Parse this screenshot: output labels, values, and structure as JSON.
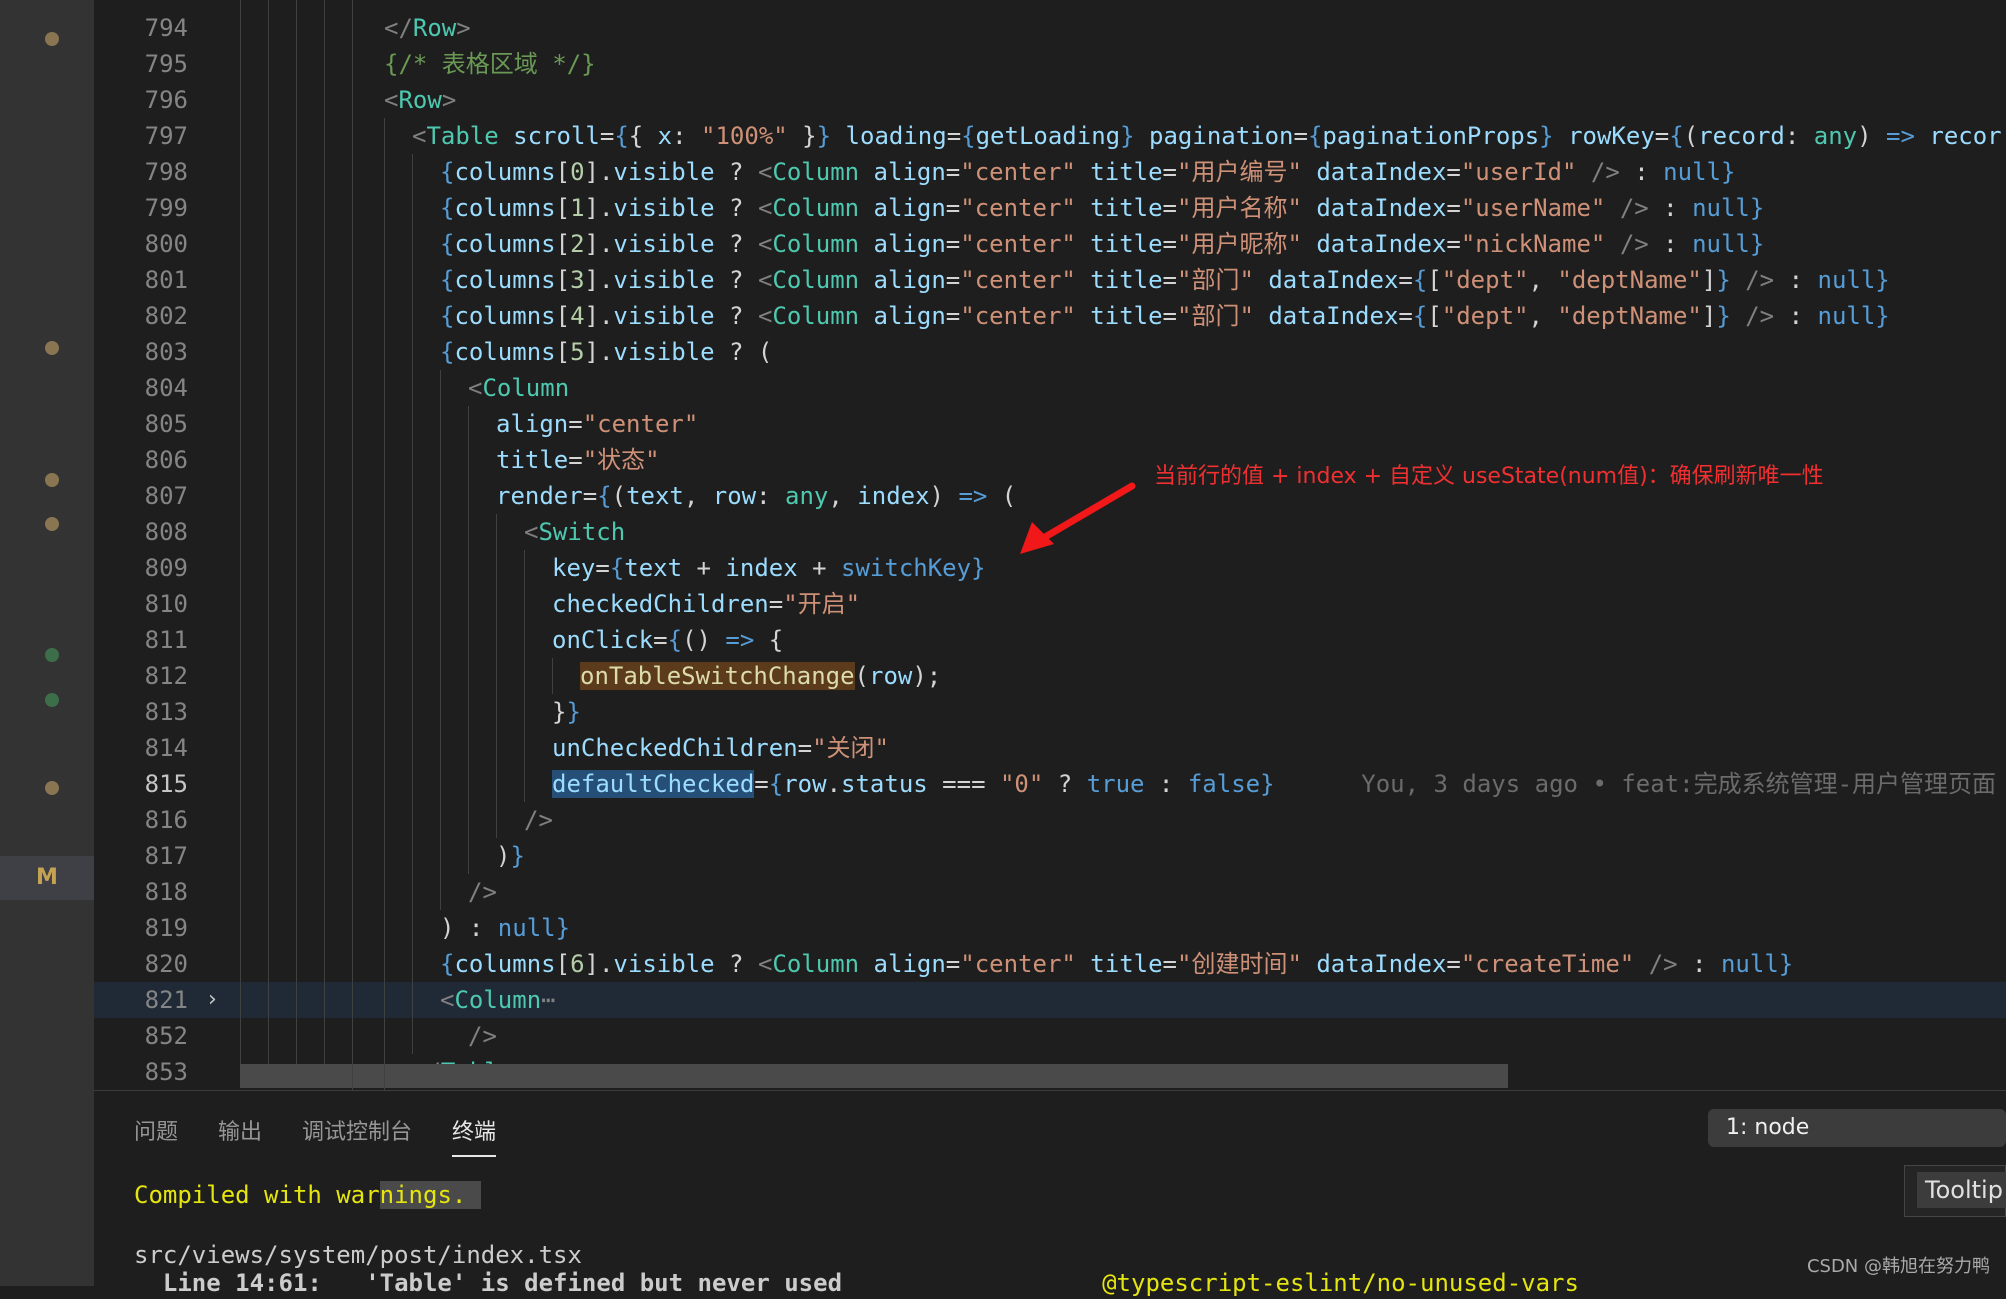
{
  "activity_bar": {
    "scm_badge": "M"
  },
  "editor": {
    "line_numbers": [
      "794",
      "795",
      "796",
      "797",
      "798",
      "799",
      "800",
      "801",
      "802",
      "803",
      "804",
      "805",
      "806",
      "807",
      "808",
      "809",
      "810",
      "811",
      "812",
      "813",
      "814",
      "815",
      "816",
      "817",
      "818",
      "819",
      "820",
      "821",
      "852",
      "853"
    ],
    "current_line": "815",
    "annotation": "当前行的值 + index + 自定义 useState(num值)：确保刷新唯一性",
    "blame": "You, 3 days ago • feat:完成系统管理-用户管理页面",
    "text": {
      "row": "Row",
      "comment": "{/* 表格区域 */}",
      "table": "Table",
      "column": "Column",
      "switch": "Switch",
      "scroll": "scroll",
      "loading": "loading",
      "pagination": "pagination",
      "rowKey": "rowKey",
      "getLoading": "getLoading",
      "paginationProps": "paginationProps",
      "record": "record",
      "any": "any",
      "align": "align",
      "center": "\"center\"",
      "title": "title",
      "dataIndex": "dataIndex",
      "columns": "columns",
      "visible": "visible",
      "null": "null",
      "userId": "\"userId\"",
      "userName": "\"userName\"",
      "nickName": "\"nickName\"",
      "dept": "\"dept\"",
      "deptName": "\"deptName\"",
      "createTime": "\"createTime\"",
      "t_userId": "\"用户编号\"",
      "t_userName": "\"用户名称\"",
      "t_nick": "\"用户昵称\"",
      "t_dept": "\"部门\"",
      "t_status": "\"状态\"",
      "t_create": "\"创建时间\"",
      "render": "render",
      "text": "text",
      "index": "index",
      "key": "key",
      "switchKey": "switchKey",
      "checkedChildren": "checkedChildren",
      "open": "\"开启\"",
      "onClick": "onClick",
      "onTableSwitchChange": "onTableSwitchChange",
      "unCheckedChildren": "unCheckedChildren",
      "close": "\"关闭\"",
      "defaultChecked": "defaultChecked",
      "status": "status",
      "zero": "\"0\"",
      "true": "true",
      "false": "false",
      "x": "x",
      "pct": "\"100%\""
    }
  },
  "panel": {
    "tabs": [
      "问题",
      "输出",
      "调试控制台",
      "终端"
    ],
    "active_tab": "终端",
    "terminal_select": "1: node",
    "tooltip": "Tooltip",
    "terminal": {
      "compiled_a": "Compiled with war",
      "compiled_b": "nings.",
      "file": "src/views/system/post/index.tsx",
      "warning_line": "  Line 14:61:   'Table' is defined but never used",
      "warning_rule": "@typescript-eslint/no-unused-vars"
    }
  },
  "watermark": "CSDN @韩旭在努力鸭"
}
